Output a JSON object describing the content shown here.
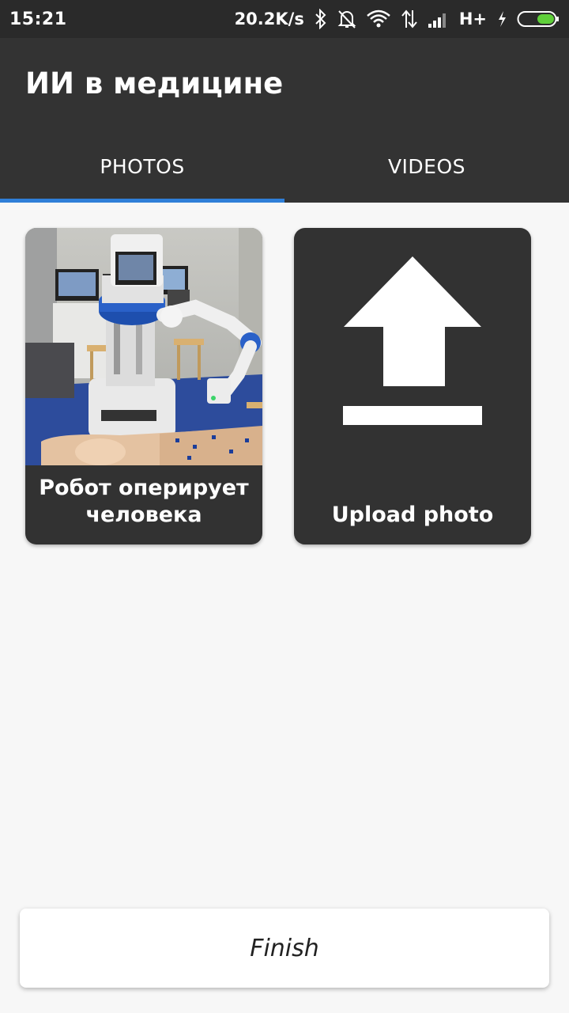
{
  "status_bar": {
    "time": "15:21",
    "network_speed": "20.2K/s",
    "network_type": "H+",
    "icons": [
      "bluetooth-icon",
      "bell-off-icon",
      "wifi-icon",
      "data-arrows-icon",
      "signal-icon",
      "charging-icon",
      "battery-icon"
    ]
  },
  "app_bar": {
    "title": "ИИ в медицине"
  },
  "tabs": [
    {
      "label": "PHOTOS",
      "selected": true
    },
    {
      "label": "VIDEOS",
      "selected": false
    }
  ],
  "cards": [
    {
      "label": "Робот оперирует человека",
      "image": "robot-surgery-photo"
    },
    {
      "label": "Upload photo",
      "icon": "upload-icon"
    }
  ],
  "finish_button": {
    "label": "Finish"
  },
  "colors": {
    "status_bar": "#2a2a2a",
    "app_bar": "#333333",
    "tab_indicator": "#2f7fd8",
    "card_background": "#323232",
    "page_background": "#f7f7f7",
    "battery_fill": "#5fcf3a"
  }
}
